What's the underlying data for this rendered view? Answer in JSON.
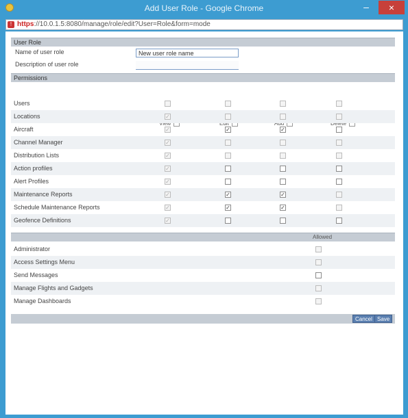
{
  "window": {
    "title": "Add User Role - Google Chrome",
    "minimize_glyph": "–",
    "close_glyph": "×"
  },
  "url": {
    "protocol": "https",
    "rest": "://10.0.1.5:8080/manage/role/edit?User=Role&form=mode"
  },
  "user_role": {
    "heading": "User Role",
    "name_label": "Name of user role",
    "name_value": "New user role name",
    "desc_label": "Description of user role",
    "desc_value": ""
  },
  "permissions": {
    "heading": "Permissions",
    "columns": [
      "View",
      "Edit",
      "Add",
      "Delete"
    ],
    "rows": [
      {
        "label": "Users",
        "checks": [
          "unchecked-disabled",
          "unchecked-disabled",
          "unchecked-disabled",
          "unchecked-disabled"
        ]
      },
      {
        "label": "Locations",
        "checks": [
          "checked-disabled",
          "unchecked-disabled",
          "unchecked-disabled",
          "unchecked-disabled"
        ]
      },
      {
        "label": "Aircraft",
        "checks": [
          "checked-disabled",
          "checked",
          "checked",
          "unchecked"
        ]
      },
      {
        "label": "Channel Manager",
        "checks": [
          "checked-disabled",
          "unchecked-disabled",
          "unchecked-disabled",
          "unchecked-disabled"
        ]
      },
      {
        "label": "Distribution Lists",
        "checks": [
          "checked-disabled",
          "unchecked-disabled",
          "unchecked-disabled",
          "unchecked-disabled"
        ]
      },
      {
        "label": "Action profiles",
        "checks": [
          "checked-disabled",
          "unchecked",
          "unchecked",
          "unchecked"
        ]
      },
      {
        "label": "Alert Profiles",
        "checks": [
          "checked-disabled",
          "unchecked",
          "unchecked",
          "unchecked"
        ]
      },
      {
        "label": "Maintenance Reports",
        "checks": [
          "checked-disabled",
          "checked",
          "checked",
          "unchecked-disabled"
        ]
      },
      {
        "label": "Schedule Maintenance Reports",
        "checks": [
          "checked-disabled",
          "checked",
          "checked",
          "unchecked-disabled"
        ]
      },
      {
        "label": "Geofence Definitions",
        "checks": [
          "checked-disabled",
          "unchecked",
          "unchecked",
          "unchecked"
        ]
      }
    ]
  },
  "extras": {
    "column": "Allowed",
    "rows": [
      {
        "label": "Administrator",
        "check": "unchecked-disabled"
      },
      {
        "label": "Access Settings Menu",
        "check": "unchecked-disabled"
      },
      {
        "label": "Send Messages",
        "check": "unchecked"
      },
      {
        "label": "Manage Flights and Gadgets",
        "check": "unchecked-disabled"
      },
      {
        "label": "Manage Dashboards",
        "check": "unchecked-disabled"
      }
    ]
  },
  "buttons": {
    "cancel": "Cancel",
    "save": "Save"
  }
}
